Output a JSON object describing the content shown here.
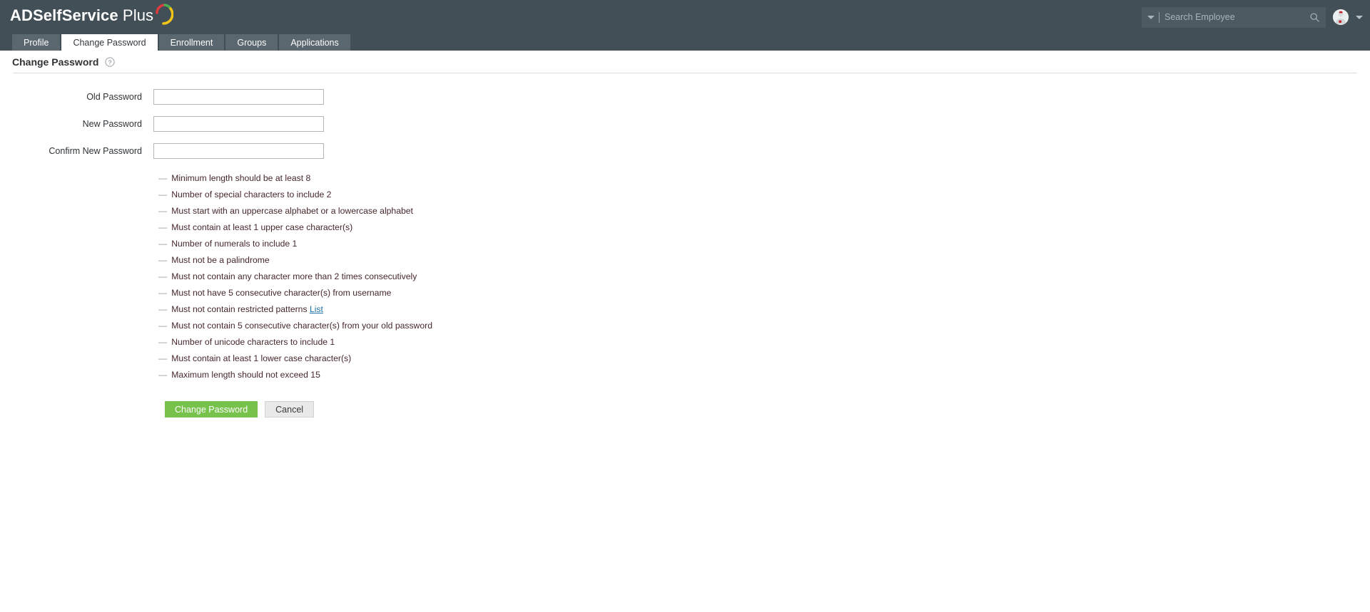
{
  "header": {
    "logo_bold": "ADSelfService",
    "logo_light": " Plus",
    "logo_swoosh_icon": "swoosh-arc-icon",
    "search": {
      "placeholder": "Search Employee",
      "value": "",
      "dropdown_icon": "chevron-down-icon",
      "search_icon": "search-icon"
    },
    "user": {
      "avatar_icon": "user-avatar",
      "caret_icon": "chevron-down-icon"
    }
  },
  "tabs": [
    {
      "label": "Profile",
      "active": false
    },
    {
      "label": "Change Password",
      "active": true
    },
    {
      "label": "Enrollment",
      "active": false
    },
    {
      "label": "Groups",
      "active": false
    },
    {
      "label": "Applications",
      "active": false
    }
  ],
  "page": {
    "title": "Change Password",
    "help_icon": "help-question-icon"
  },
  "form": {
    "fields": [
      {
        "label": "Old Password",
        "value": "",
        "name": "old-password-input"
      },
      {
        "label": "New Password",
        "value": "",
        "name": "new-password-input"
      },
      {
        "label": "Confirm New Password",
        "value": "",
        "name": "confirm-new-password-input"
      }
    ]
  },
  "rules": [
    {
      "text": "Minimum length should be at least 8"
    },
    {
      "text": "Number of special characters to include 2"
    },
    {
      "text": "Must start with an uppercase alphabet or a lowercase alphabet"
    },
    {
      "text": "Must contain at least 1 upper case character(s)"
    },
    {
      "text": "Number of numerals to include 1"
    },
    {
      "text": "Must not be a palindrome"
    },
    {
      "text": "Must not contain any character more than 2 times consecutively"
    },
    {
      "text": "Must not have 5 consecutive character(s) from username"
    },
    {
      "text": "Must not contain restricted patterns ",
      "link": "List"
    },
    {
      "text": "Must not contain 5 consecutive character(s) from your old password"
    },
    {
      "text": "Number of unicode characters to include 1"
    },
    {
      "text": "Must contain at least 1 lower case character(s)"
    },
    {
      "text": "Maximum length should not exceed 15"
    }
  ],
  "buttons": {
    "primary": "Change Password",
    "secondary": "Cancel"
  },
  "colors": {
    "header_bg": "#434f57",
    "tab_bg": "#5a676f",
    "primary_btn": "#77c24b",
    "link": "#1f6fa8",
    "rule_text": "#46272a"
  }
}
